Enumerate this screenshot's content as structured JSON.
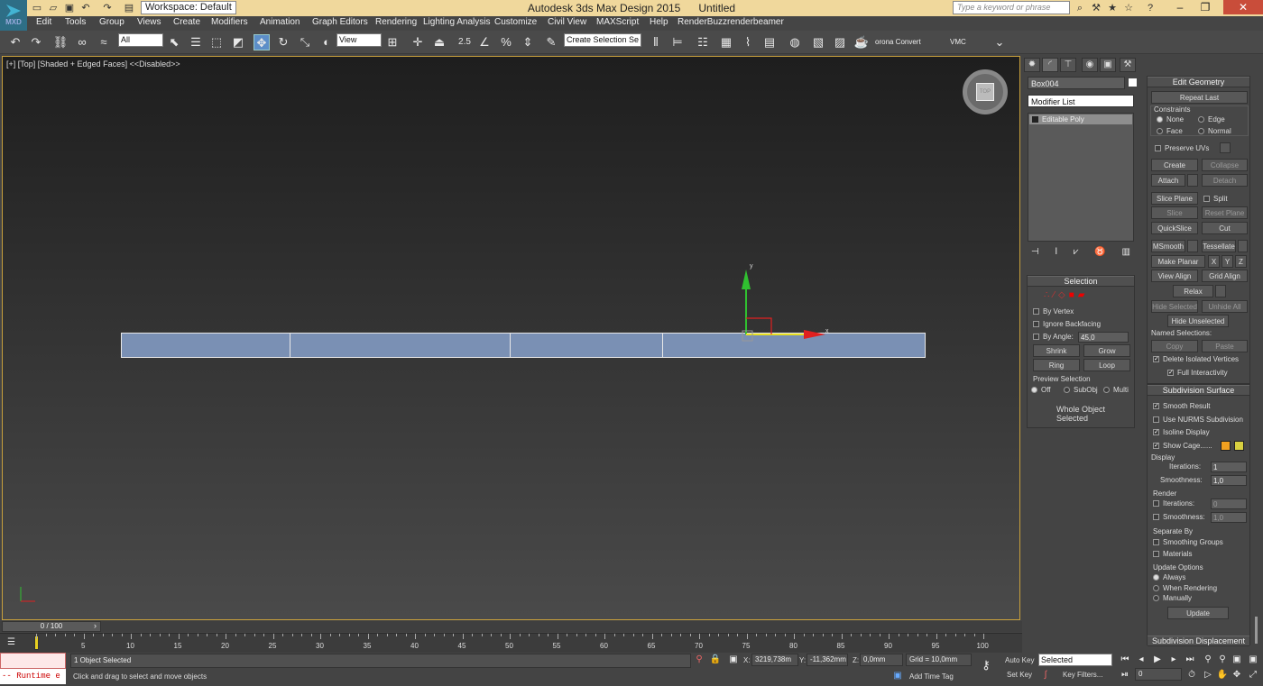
{
  "app": {
    "title": "Autodesk 3ds Max Design 2015      Untitled",
    "logo_label": "MXD",
    "workspace_label": "Workspace: Default",
    "search_placeholder": "Type a keyword or phrase",
    "colors": {
      "titlebar": "#f0d89c",
      "viewport_border": "#c8a03c",
      "box_fill": "#7a90b4",
      "accent_selected": "#5c8ec8",
      "close_button": "#c94d3a"
    }
  },
  "menu": {
    "items": [
      "Edit",
      "Tools",
      "Group",
      "Views",
      "Create",
      "Modifiers",
      "Animation",
      "Graph Editors",
      "Rendering",
      "Lighting Analysis",
      "Customize",
      "Civil View",
      "MAXScript",
      "Help",
      "RenderBuzz",
      "renderbeamer"
    ]
  },
  "toolbar": {
    "selection_filter": "All",
    "reference_coord": "View",
    "snap_label": "2.5",
    "named_selection_placeholder": "Create Selection Se",
    "corona_label": "orona Convert",
    "vmc_label": "VMC"
  },
  "viewport": {
    "label": "[+] [Top] [Shaded + Edged Faces]  <<Disabled>>",
    "viewcube_face": "TOP",
    "gizmo_x": "x",
    "gizmo_y": "y"
  },
  "command_panel": {
    "object_name": "Box004",
    "modifier_list": "Modifier List",
    "stack": [
      "Editable Poly"
    ],
    "edit_geometry": {
      "header": "Edit Geometry",
      "repeat_last": "Repeat Last",
      "constraints_label": "Constraints",
      "constraints": [
        "None",
        "Edge",
        "Face",
        "Normal"
      ],
      "preserve_uvs": "Preserve UVs",
      "create": "Create",
      "collapse": "Collapse",
      "attach": "Attach",
      "detach": "Detach",
      "slice_plane": "Slice Plane",
      "split": "Split",
      "slice": "Slice",
      "reset_plane": "Reset Plane",
      "quickslice": "QuickSlice",
      "cut": "Cut",
      "msmooth": "MSmooth",
      "tessellate": "Tessellate",
      "make_planar": "Make Planar",
      "axis_x": "X",
      "axis_y": "Y",
      "axis_z": "Z",
      "view_align": "View Align",
      "grid_align": "Grid Align",
      "relax": "Relax",
      "hide_selected": "Hide Selected",
      "unhide_all": "Unhide All",
      "hide_unselected": "Hide Unselected",
      "named_selections": "Named Selections:",
      "copy": "Copy",
      "paste": "Paste",
      "delete_isolated": "Delete Isolated Vertices",
      "full_interactivity": "Full Interactivity"
    },
    "selection": {
      "header": "Selection",
      "by_vertex": "By Vertex",
      "ignore_backfacing": "Ignore Backfacing",
      "by_angle": "By Angle:",
      "angle_value": "45,0",
      "shrink": "Shrink",
      "grow": "Grow",
      "ring": "Ring",
      "loop": "Loop",
      "preview_label": "Preview Selection",
      "preview_options": [
        "Off",
        "SubObj",
        "Multi"
      ],
      "status": "Whole Object Selected"
    },
    "subdivision": {
      "header": "Subdivision Surface",
      "smooth_result": "Smooth Result",
      "use_nurms": "Use NURMS Subdivision",
      "isoline_display": "Isoline Display",
      "show_cage": "Show Cage......",
      "display_label": "Display",
      "iterations_label": "Iterations:",
      "iterations_value": "1",
      "smoothness_label": "Smoothness:",
      "smoothness_value": "1,0",
      "render_label": "Render",
      "render_iterations_value": "0",
      "render_smoothness_value": "1,0",
      "separate_by": "Separate By",
      "smoothing_groups": "Smoothing Groups",
      "materials": "Materials",
      "update_options": "Update Options",
      "update_choices": [
        "Always",
        "When Rendering",
        "Manually"
      ],
      "update": "Update",
      "cage_color_1": "#f0a020",
      "cage_color_2": "#d8d040"
    },
    "subdivision_displacement": "Subdivision Displacement"
  },
  "timeline": {
    "range": "0 / 100",
    "ticks": [
      "5",
      "10",
      "15",
      "20",
      "25",
      "30",
      "35",
      "40",
      "45",
      "50",
      "55",
      "60",
      "65",
      "70",
      "75",
      "80",
      "85",
      "90",
      "95",
      "100"
    ]
  },
  "status": {
    "maxscript": "-- Runtime e",
    "selection_info": "1 Object Selected",
    "prompt": "Click and drag to select and move objects",
    "x_label": "X:",
    "x_value": "3219,738m",
    "y_label": "Y:",
    "y_value": "-11,362mm",
    "z_label": "Z:",
    "z_value": "0,0mm",
    "grid": "Grid = 10,0mm",
    "add_time_tag": "Add Time Tag",
    "auto_key": "Auto Key",
    "key_mode": "Selected",
    "set_key": "Set Key",
    "key_filters": "Key Filters...",
    "current_frame": "0"
  }
}
